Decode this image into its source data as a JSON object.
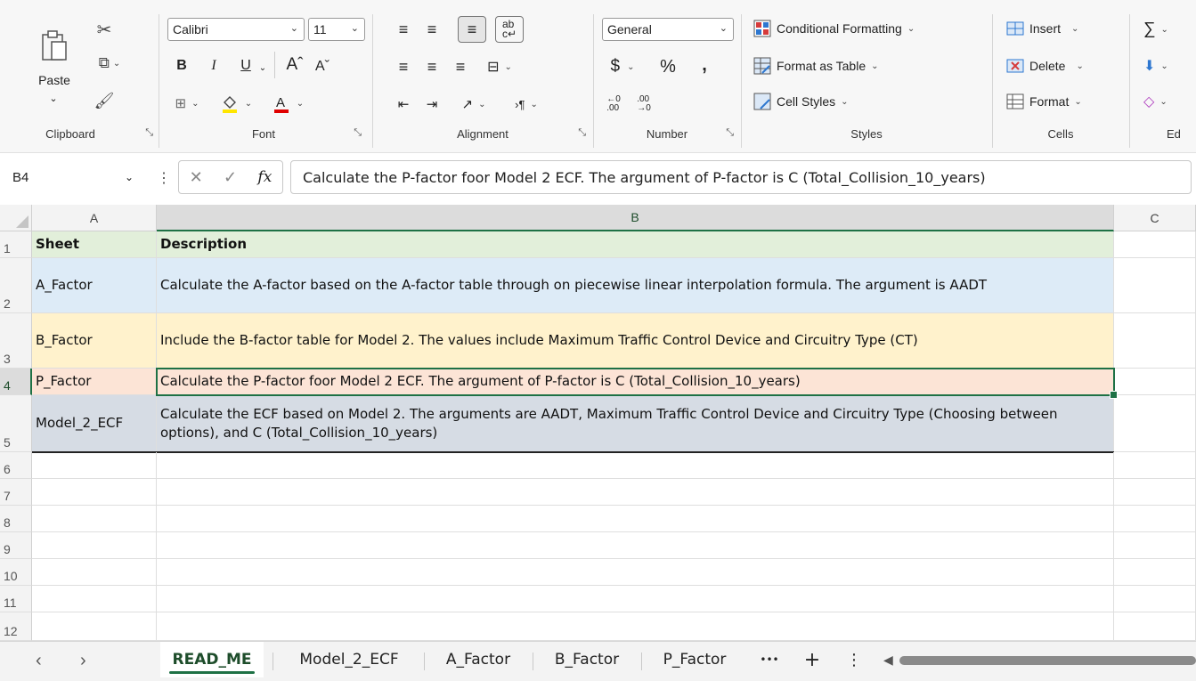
{
  "ribbon": {
    "clipboard": {
      "paste": "Paste",
      "label": "Clipboard"
    },
    "font": {
      "name": "Calibri",
      "size": "11",
      "label": "Font",
      "bold": "B",
      "italic": "I",
      "underline": "U",
      "grow": "Aˆ",
      "shrink": "Aˇ"
    },
    "alignment": {
      "label": "Alignment"
    },
    "number": {
      "format": "General",
      "currency": "$",
      "percent": "%",
      "comma": ")",
      "label": "Number"
    },
    "styles": {
      "conditional": "Conditional Formatting",
      "table": "Format as Table",
      "cell_styles": "Cell Styles",
      "label": "Styles"
    },
    "cells": {
      "insert": "Insert",
      "delete": "Delete",
      "format": "Format",
      "label": "Cells"
    },
    "editing": {
      "label": "Ed"
    }
  },
  "formula_bar": {
    "name_box": "B4",
    "formula": "Calculate the P-factor foor Model 2 ECF. The argument of P-factor is C (Total_Collision_10_years)"
  },
  "grid": {
    "columns": [
      "A",
      "B",
      "C"
    ],
    "rows": [
      {
        "num": "1",
        "a": "Sheet",
        "b": "Description"
      },
      {
        "num": "2",
        "a": "A_Factor",
        "b": "Calculate the A-factor based on the A-factor table through on piecewise linear interpolation formula. The argument is AADT"
      },
      {
        "num": "3",
        "a": "B_Factor",
        "b": "Include the B-factor table for Model 2. The values include Maximum Traffic Control Device and Circuitry Type (CT)"
      },
      {
        "num": "4",
        "a": "P_Factor",
        "b": "Calculate the P-factor foor Model 2 ECF. The argument of P-factor is C (Total_Collision_10_years)"
      },
      {
        "num": "5",
        "a": "Model_2_ECF",
        "b": "Calculate the ECF based on Model 2. The arguments are AADT, Maximum Traffic Control Device and Circuitry Type (Choosing between options), and C (Total_Collision_10_years)"
      },
      {
        "num": "6"
      },
      {
        "num": "7"
      },
      {
        "num": "8"
      },
      {
        "num": "9"
      },
      {
        "num": "10"
      },
      {
        "num": "11"
      },
      {
        "num": "12"
      }
    ],
    "row_colors": {
      "1": "#e2efda",
      "2": "#ddebf7",
      "3": "#fff2cc",
      "4": "#fce4d6",
      "5": "#d6dce4"
    }
  },
  "sheet_tabs": {
    "tabs": [
      "READ_ME",
      "Model_2_ECF",
      "A_Factor",
      "B_Factor",
      "P_Factor"
    ],
    "active": "READ_ME",
    "more": "•••",
    "add": "+",
    "options": "⋮"
  },
  "colors": {
    "accent": "#1e7145"
  }
}
